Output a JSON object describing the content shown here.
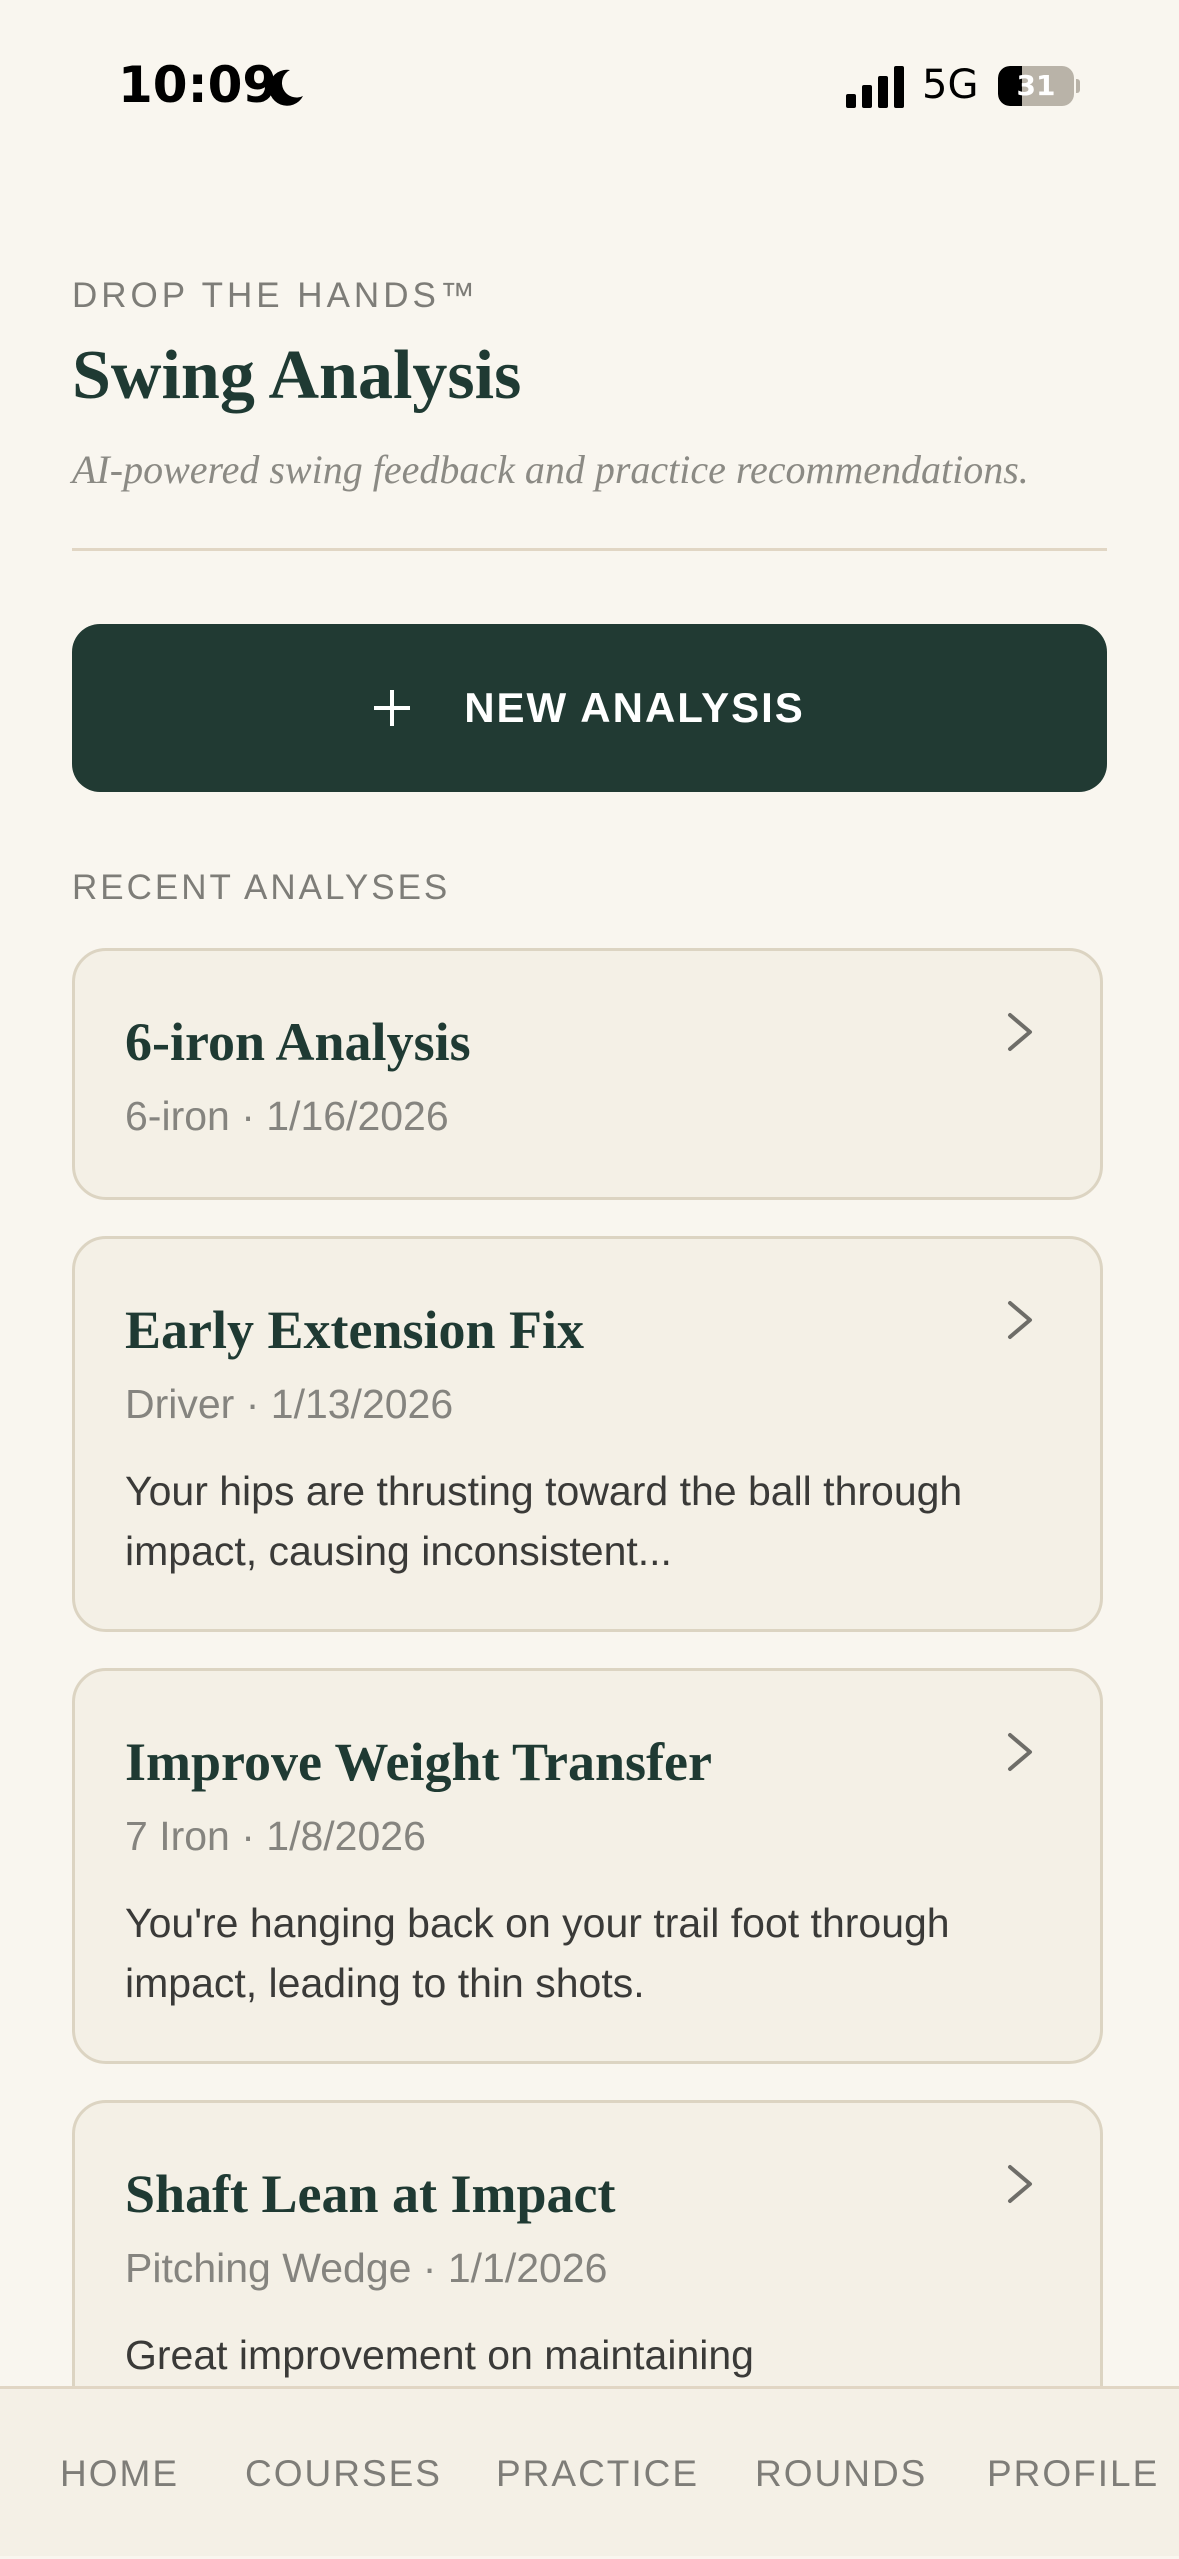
{
  "status_bar": {
    "time": "10:09",
    "network": "5G",
    "battery_level": "31",
    "battery_fraction": 0.31,
    "icons": [
      "moon-icon",
      "signal-icon",
      "battery-icon"
    ]
  },
  "header": {
    "eyebrow": "DROP THE HANDS™",
    "title": "Swing Analysis",
    "subtitle": "AI-powered swing feedback and practice recommendations."
  },
  "primary_action": {
    "icon": "plus-icon",
    "label": "NEW ANALYSIS"
  },
  "recent": {
    "heading": "RECENT ANALYSES",
    "items": [
      {
        "title": "6-iron Analysis",
        "meta": "6-iron · 1/16/2026",
        "summary": ""
      },
      {
        "title": "Early Extension Fix",
        "meta": "Driver · 1/13/2026",
        "summary": "Your hips are thrusting toward the ball through impact, causing inconsistent..."
      },
      {
        "title": "Improve Weight Transfer",
        "meta": "7 Iron · 1/8/2026",
        "summary": "You're hanging back on your trail foot through impact, leading to thin shots."
      },
      {
        "title": "Shaft Lean at Impact",
        "meta": "Pitching Wedge · 1/1/2026",
        "summary": "Great improvement on maintaining"
      }
    ]
  },
  "tab_bar": {
    "tabs": [
      {
        "label": "HOME"
      },
      {
        "label": "COURSES"
      },
      {
        "label": "PRACTICE"
      },
      {
        "label": "ROUNDS"
      },
      {
        "label": "PROFILE"
      }
    ]
  },
  "colors": {
    "background": "#f9f6ef",
    "card_background": "#f4f0e6",
    "accent_dark_green": "#213a33",
    "muted_text": "#7e7d78",
    "border": "#dcd4c2"
  }
}
